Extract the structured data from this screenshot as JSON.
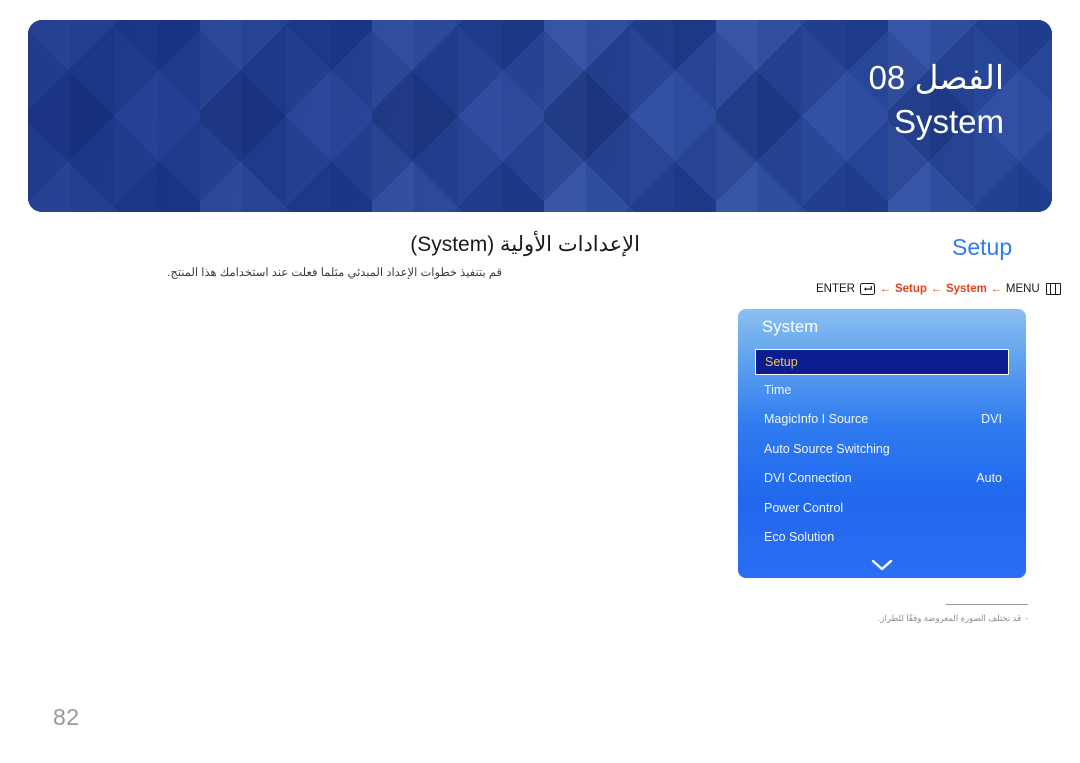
{
  "banner": {
    "chapter_label": "الفصل 08",
    "chapter_title": "System",
    "bg_color": "#22429d"
  },
  "section": {
    "title_ar": "الإعدادات الأولية (System)",
    "subtitle_ar": "قم بتنفيذ خطوات الإعداد المبدئي مثلما فعلت عند استخدامك هذا المنتج.",
    "heading_en": "Setup",
    "heading_color": "#2f7bf4"
  },
  "breadcrumb": {
    "enter_label": "ENTER",
    "enter_icon": "enter-key-icon",
    "arrow": "←",
    "steps": [
      {
        "label": "Setup",
        "accent": true
      },
      {
        "label": "System",
        "accent": true
      },
      {
        "label": "MENU",
        "accent": false
      }
    ],
    "menu_icon": "menu-grid-icon",
    "accent_color": "#e8411c"
  },
  "osd": {
    "title": "System",
    "selected_index": 0,
    "selected_text_color": "#f6c944",
    "selected_bg_color": "#0d1d8f",
    "scroll_down_icon": "chevron-down-icon",
    "items": [
      {
        "label": "Setup",
        "value": ""
      },
      {
        "label": "Time",
        "value": ""
      },
      {
        "label": "MagicInfo I Source",
        "value": "DVI"
      },
      {
        "label": "Auto Source Switching",
        "value": ""
      },
      {
        "label": "DVI Connection",
        "value": "Auto"
      },
      {
        "label": "Power Control",
        "value": ""
      },
      {
        "label": "Eco Solution",
        "value": ""
      }
    ]
  },
  "footnote": {
    "dash": "-",
    "text_ar": "قد تختلف الصورة المعروضة وفقًا للطراز."
  },
  "page": {
    "number": "82"
  }
}
